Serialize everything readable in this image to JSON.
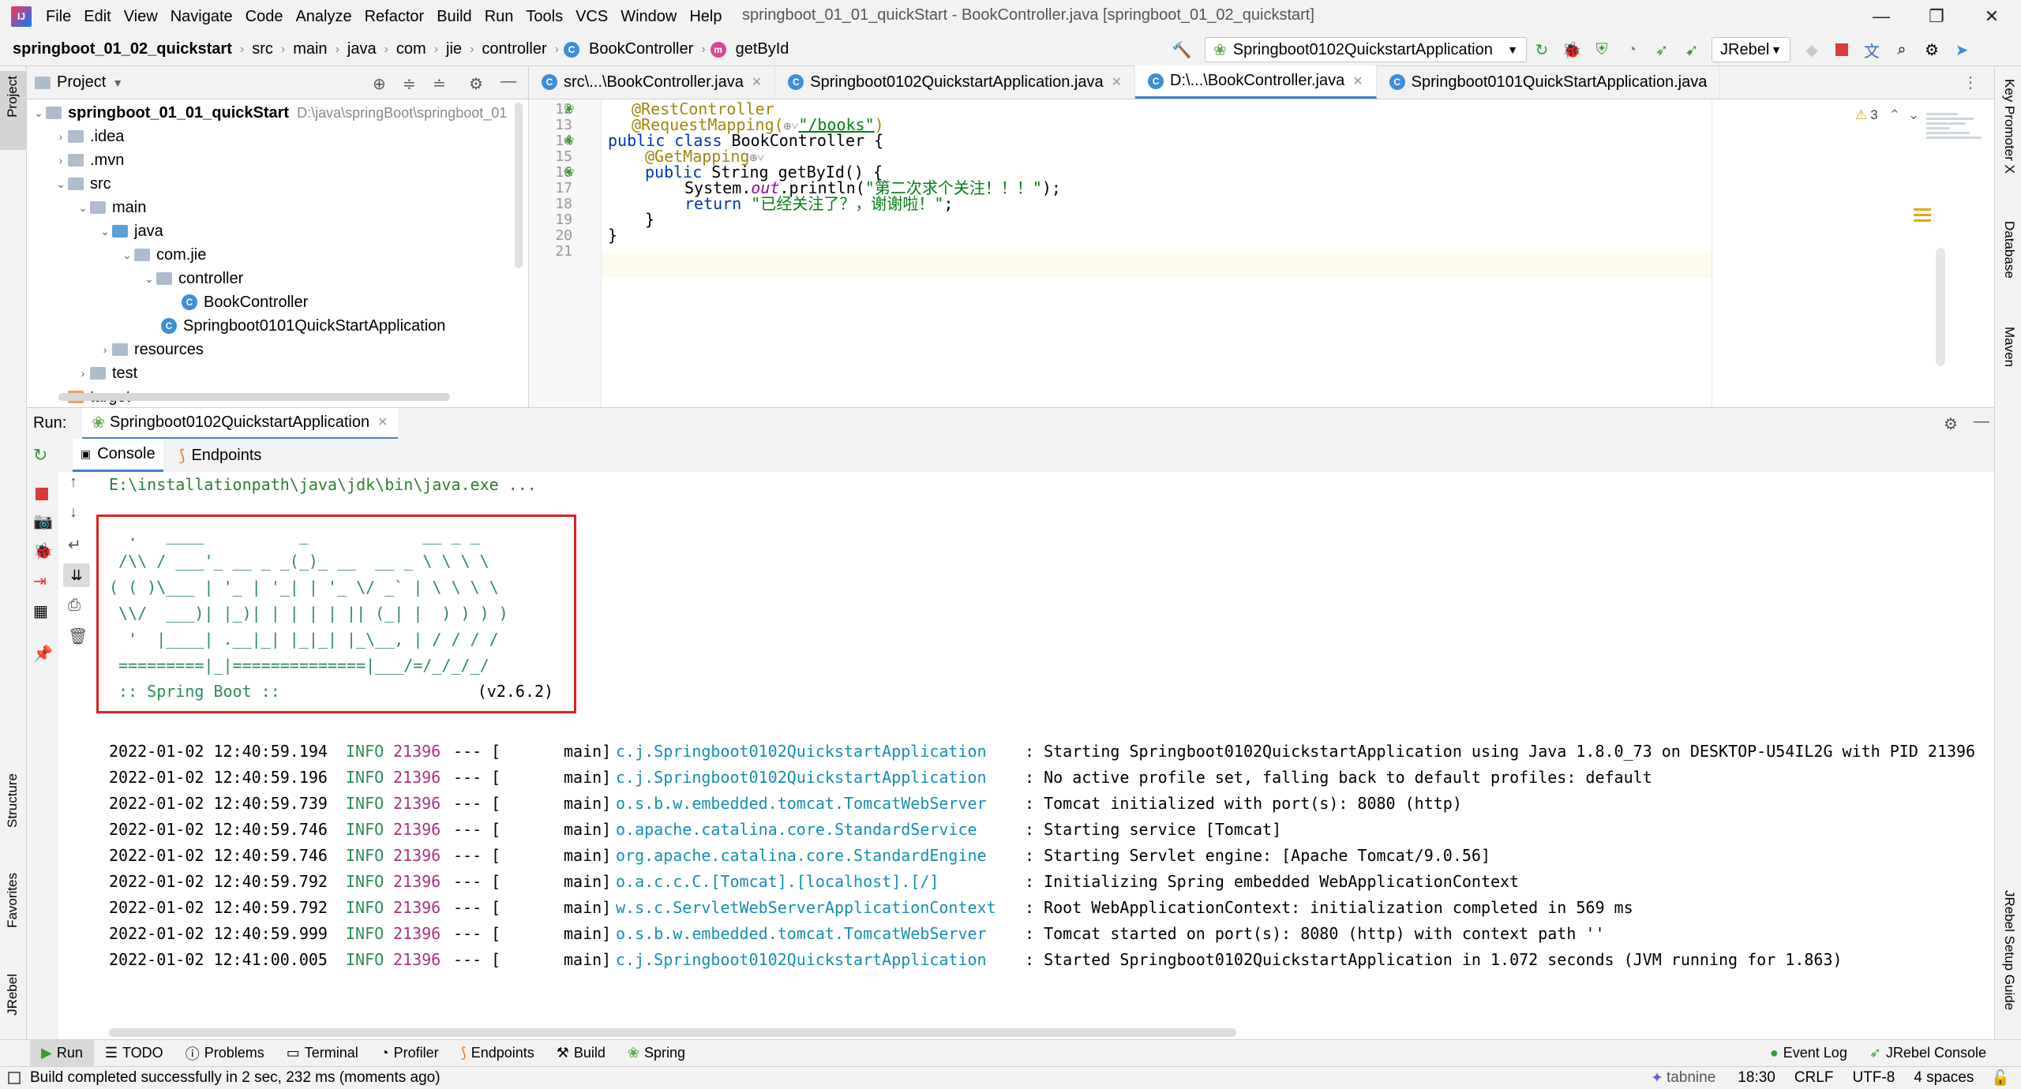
{
  "menu": {
    "items": [
      "File",
      "Edit",
      "View",
      "Navigate",
      "Code",
      "Analyze",
      "Refactor",
      "Build",
      "Run",
      "Tools",
      "VCS",
      "Window",
      "Help"
    ],
    "window_title": "springboot_01_01_quickStart - BookController.java [springboot_01_02_quickstart]"
  },
  "breadcrumb": [
    "springboot_01_02_quickstart",
    "src",
    "main",
    "java",
    "com",
    "jie",
    "controller",
    "BookController",
    "getById"
  ],
  "toolbar": {
    "run_config": "Springboot0102QuickstartApplication",
    "jrebel": "JRebel"
  },
  "project": {
    "title": "Project",
    "root": "springboot_01_01_quickStart",
    "root_path": "D:\\java\\springBoot\\springboot_01",
    "nodes": [
      ".idea",
      ".mvn",
      "src",
      "main",
      "java",
      "com.jie",
      "controller",
      "BookController",
      "Springboot0101QuickStartApplication",
      "resources",
      "test",
      "target"
    ]
  },
  "editor": {
    "tabs": [
      "src\\...\\BookController.java",
      "Springboot0102QuickstartApplication.java",
      "D:\\...\\BookController.java",
      "Springboot0101QuickStartApplication.java"
    ],
    "warnings": "3",
    "line_numbers": [
      "12",
      "13",
      "14",
      "15",
      "16",
      "17",
      "18",
      "19",
      "20",
      "21"
    ],
    "code": {
      "l12": "@RestController",
      "l13a": "@RequestMapping(",
      "l13b": "\"/books\"",
      "l13c": ")",
      "l14a": "public class ",
      "l14b": "BookController {",
      "l15": "@GetMapping",
      "l16a": "public ",
      "l16b": "String getById() {",
      "l17a": "System.",
      "l17b": "out",
      "l17c": ".println(",
      "l17d": "\"第二次求个关注！！！\"",
      "l17e": ");",
      "l18a": "return ",
      "l18b": "\"已经关注了？，谢谢啦！\"",
      "l18c": ";",
      "l19": "}",
      "l20": "}"
    }
  },
  "run": {
    "label": "Run:",
    "config_tab": "Springboot0102QuickstartApplication",
    "subtabs": [
      "Console",
      "Endpoints"
    ],
    "command": "E:\\installationpath\\java\\jdk\\bin\\java.exe ...",
    "banner": [
      "  .   ____          _            __ _ _",
      " /\\\\ / ___'_ __ _ _(_)_ __  __ _ \\ \\ \\ \\",
      "( ( )\\___ | '_ | '_| | '_ \\/ _` | \\ \\ \\ \\",
      " \\\\/  ___)| |_)| | | | | || (_| |  ) ) ) )",
      "  '  |____| .__|_| |_|_| |_\\__, | / / / /",
      " =========|_|==============|___/=/_/_/_/"
    ],
    "banner_footer_a": " :: Spring Boot ::",
    "banner_footer_b": "(v2.6.2)",
    "logs": [
      {
        "time": "2022-01-02 12:40:59.194",
        "level": "INFO",
        "pid": "21396",
        "sep": "--- [",
        "thread": "main]",
        "logger": "c.j.Springboot0102QuickstartApplication",
        "msg": ": Starting Springboot0102QuickstartApplication using Java 1.8.0_73 on DESKTOP-U54IL2G with PID 21396"
      },
      {
        "time": "2022-01-02 12:40:59.196",
        "level": "INFO",
        "pid": "21396",
        "sep": "--- [",
        "thread": "main]",
        "logger": "c.j.Springboot0102QuickstartApplication",
        "msg": ": No active profile set, falling back to default profiles: default"
      },
      {
        "time": "2022-01-02 12:40:59.739",
        "level": "INFO",
        "pid": "21396",
        "sep": "--- [",
        "thread": "main]",
        "logger": "o.s.b.w.embedded.tomcat.TomcatWebServer",
        "msg": ": Tomcat initialized with port(s): 8080 (http)"
      },
      {
        "time": "2022-01-02 12:40:59.746",
        "level": "INFO",
        "pid": "21396",
        "sep": "--- [",
        "thread": "main]",
        "logger": "o.apache.catalina.core.StandardService",
        "msg": ": Starting service [Tomcat]"
      },
      {
        "time": "2022-01-02 12:40:59.746",
        "level": "INFO",
        "pid": "21396",
        "sep": "--- [",
        "thread": "main]",
        "logger": "org.apache.catalina.core.StandardEngine",
        "msg": ": Starting Servlet engine: [Apache Tomcat/9.0.56]"
      },
      {
        "time": "2022-01-02 12:40:59.792",
        "level": "INFO",
        "pid": "21396",
        "sep": "--- [",
        "thread": "main]",
        "logger": "o.a.c.c.C.[Tomcat].[localhost].[/]",
        "msg": ": Initializing Spring embedded WebApplicationContext"
      },
      {
        "time": "2022-01-02 12:40:59.792",
        "level": "INFO",
        "pid": "21396",
        "sep": "--- [",
        "thread": "main]",
        "logger": "w.s.c.ServletWebServerApplicationContext",
        "msg": ": Root WebApplicationContext: initialization completed in 569 ms"
      },
      {
        "time": "2022-01-02 12:40:59.999",
        "level": "INFO",
        "pid": "21396",
        "sep": "--- [",
        "thread": "main]",
        "logger": "o.s.b.w.embedded.tomcat.TomcatWebServer",
        "msg": ": Tomcat started on port(s): 8080 (http) with context path ''"
      },
      {
        "time": "2022-01-02 12:41:00.005",
        "level": "INFO",
        "pid": "21396",
        "sep": "--- [",
        "thread": "main]",
        "logger": "c.j.Springboot0102QuickstartApplication",
        "msg": ": Started Springboot0102QuickstartApplication in 1.072 seconds (JVM running for 1.863)"
      }
    ]
  },
  "left_stripe": {
    "project": "Project",
    "structure": "Structure",
    "favorites": "Favorites",
    "jrebel": "JRebel"
  },
  "right_stripe": {
    "key_promoter": "Key Promoter X",
    "database": "Database",
    "maven": "Maven",
    "jrebel_guide": "JRebel Setup Guide"
  },
  "bottom_tools": [
    "Run",
    "TODO",
    "Problems",
    "Terminal",
    "Profiler",
    "Endpoints",
    "Build",
    "Spring"
  ],
  "bottom_right": [
    "Event Log",
    "JRebel Console"
  ],
  "status": {
    "message": "Build completed successfully in 2 sec, 232 ms (moments ago)",
    "tabnine": "tabnine",
    "position": "18:30",
    "line_sep": "CRLF",
    "encoding": "UTF-8",
    "indent": "4 spaces"
  },
  "colors": {
    "accent": "#4083c9",
    "banner_box": "#e02020",
    "info": "#2e8b57",
    "pid": "#a8327f",
    "logger": "#168eb1"
  }
}
